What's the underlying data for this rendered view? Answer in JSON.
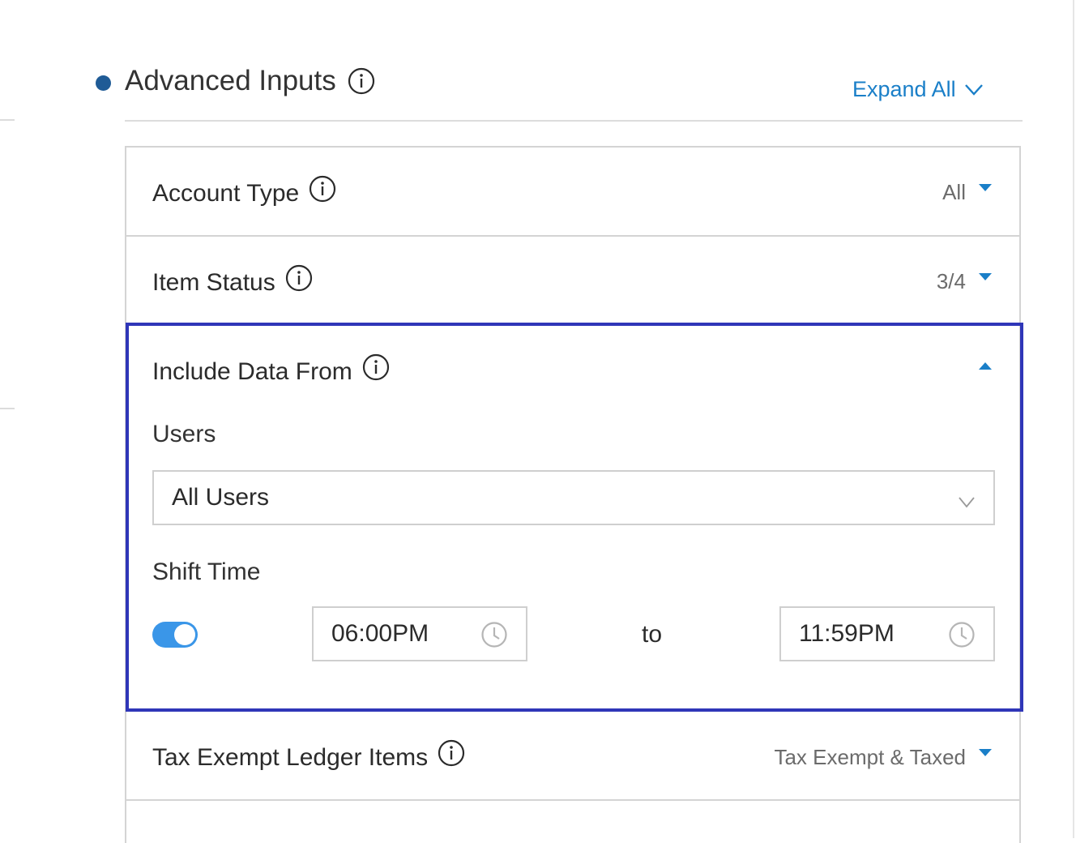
{
  "section": {
    "title": "Advanced Inputs",
    "expand_all_label": "Expand All"
  },
  "rows": {
    "account_type": {
      "label": "Account Type",
      "value": "All"
    },
    "item_status": {
      "label": "Item Status",
      "value": "3/4"
    },
    "include_data_from": {
      "label": "Include Data From",
      "users_label": "Users",
      "users_value": "All Users",
      "shift_time_label": "Shift Time",
      "shift_enabled": true,
      "start_time": "06:00PM",
      "to_label": "to",
      "end_time": "11:59PM"
    },
    "tax_exempt": {
      "label": "Tax Exempt Ledger Items",
      "value": "Tax Exempt & Taxed"
    }
  },
  "colors": {
    "accent": "#1a7fc8",
    "focus_border": "#2f36b8",
    "section_dot": "#1f5b96",
    "toggle_on": "#3a96e8"
  },
  "icons": [
    "info-icon",
    "chevron-down-icon",
    "caret-down-icon",
    "caret-up-icon",
    "clock-icon"
  ]
}
